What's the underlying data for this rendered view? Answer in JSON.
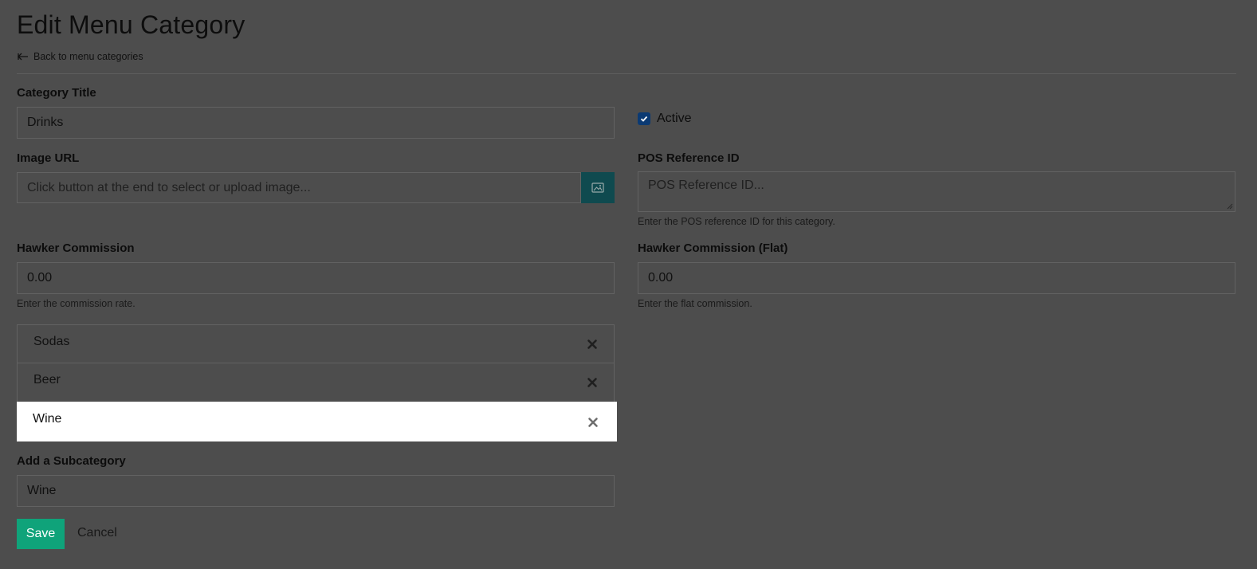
{
  "header": {
    "title": "Edit Menu Category",
    "back_label": "Back to menu categories"
  },
  "category_title": {
    "label": "Category Title",
    "value": "Drinks"
  },
  "active": {
    "label": "Active",
    "checked": true
  },
  "image_url": {
    "label": "Image URL",
    "placeholder": "Click button at the end to select or upload image...",
    "button_icon": "image-icon"
  },
  "pos_reference": {
    "label": "POS Reference ID",
    "placeholder": "POS Reference ID...",
    "help": "Enter the POS reference ID for this category."
  },
  "hawker_commission": {
    "label": "Hawker Commission",
    "value": "0.00",
    "help": "Enter the commission rate."
  },
  "hawker_commission_flat": {
    "label": "Hawker Commission (Flat)",
    "value": "0.00",
    "help": "Enter the flat commission."
  },
  "subcategories": [
    {
      "name": "Sodas"
    },
    {
      "name": "Beer"
    },
    {
      "name": "Wine"
    }
  ],
  "add_subcategory": {
    "label": "Add a Subcategory",
    "value": "Wine"
  },
  "actions": {
    "save_label": "Save",
    "cancel_label": "Cancel"
  },
  "colors": {
    "overlay_bg": "#4d4d4d",
    "save_button": "#0fa37a",
    "image_button": "#0f4a4f",
    "checkbox": "#0b3a73",
    "highlight_row": "#ffffff"
  }
}
